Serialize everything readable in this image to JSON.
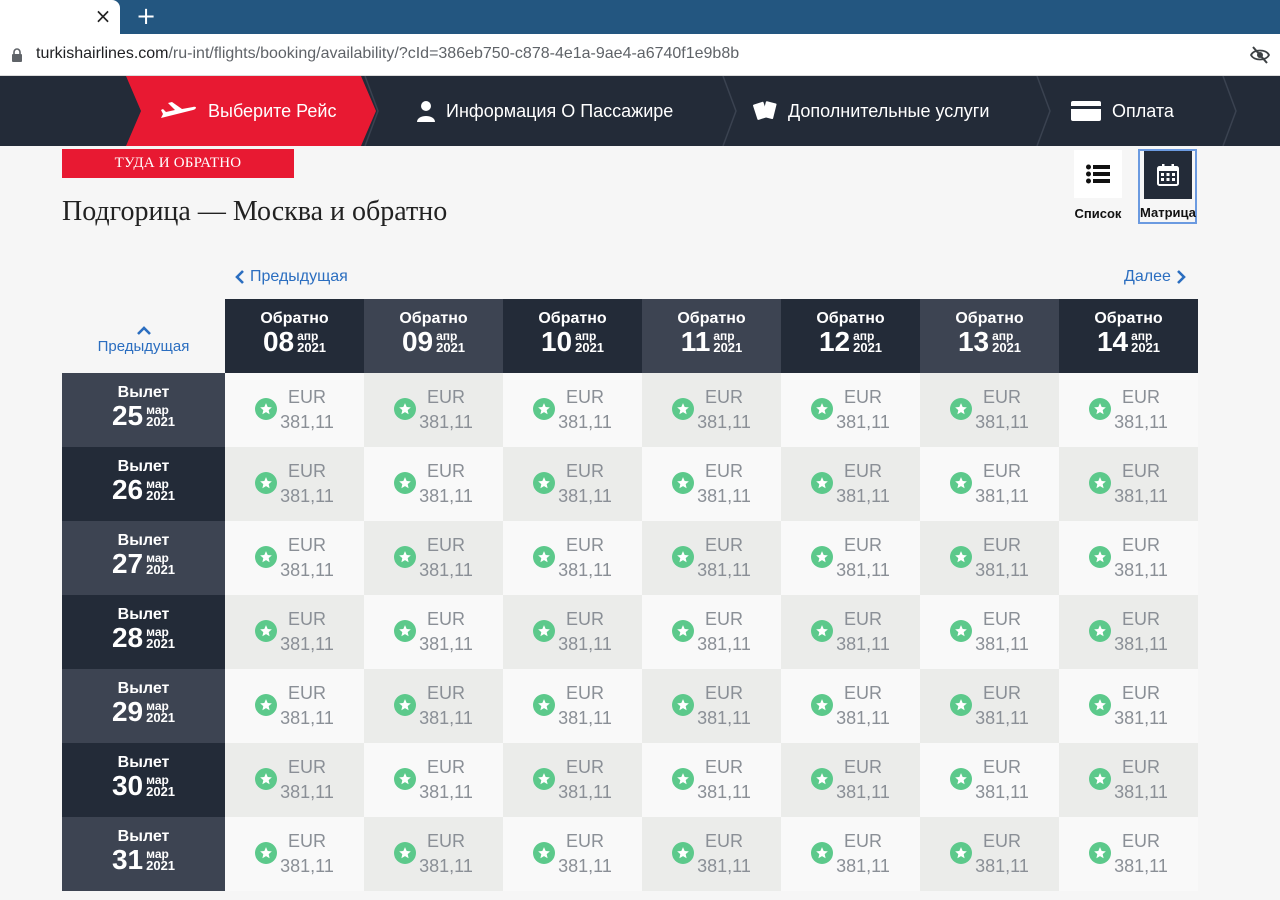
{
  "browser": {
    "tab_close": "×",
    "new_tab": "+",
    "url_host": "turkishairlines.com",
    "url_path": "/ru-int/flights/booking/availability/?cId=386eb750-c878-4e1a-9ae4-a6740f1e9b8b"
  },
  "steps": [
    {
      "label": "Выберите Рейс",
      "icon": "airplane-icon",
      "active": true
    },
    {
      "label": "Информация О Пассажире",
      "icon": "person-icon",
      "active": false
    },
    {
      "label": "Дополнительные услуги",
      "icon": "cards-icon",
      "active": false
    },
    {
      "label": "Оплата",
      "icon": "credit-card-icon",
      "active": false
    }
  ],
  "trip_badge": "ТУДА И ОБРАТНО",
  "route_title": "Подгорица — Москва и обратно",
  "view_toggle": {
    "list_label": "Список",
    "matrix_label": "Матрица",
    "selected": "matrix"
  },
  "nav": {
    "prev_horizontal": "Предыдущая",
    "next_horizontal": "Далее",
    "prev_vertical": "Предыдущая"
  },
  "return_dates": [
    {
      "label": "Обратно",
      "day": "08",
      "month": "апр",
      "year": "2021"
    },
    {
      "label": "Обратно",
      "day": "09",
      "month": "апр",
      "year": "2021"
    },
    {
      "label": "Обратно",
      "day": "10",
      "month": "апр",
      "year": "2021"
    },
    {
      "label": "Обратно",
      "day": "11",
      "month": "апр",
      "year": "2021"
    },
    {
      "label": "Обратно",
      "day": "12",
      "month": "апр",
      "year": "2021"
    },
    {
      "label": "Обратно",
      "day": "13",
      "month": "апр",
      "year": "2021"
    },
    {
      "label": "Обратно",
      "day": "14",
      "month": "апр",
      "year": "2021"
    }
  ],
  "departure_dates": [
    {
      "label": "Вылет",
      "day": "25",
      "month": "мар",
      "year": "2021"
    },
    {
      "label": "Вылет",
      "day": "26",
      "month": "мар",
      "year": "2021"
    },
    {
      "label": "Вылет",
      "day": "27",
      "month": "мар",
      "year": "2021"
    },
    {
      "label": "Вылет",
      "day": "28",
      "month": "мар",
      "year": "2021"
    },
    {
      "label": "Вылет",
      "day": "29",
      "month": "мар",
      "year": "2021"
    },
    {
      "label": "Вылет",
      "day": "30",
      "month": "мар",
      "year": "2021"
    },
    {
      "label": "Вылет",
      "day": "31",
      "month": "мар",
      "year": "2021"
    }
  ],
  "prices": [
    [
      {
        "currency": "EUR",
        "amount": "381,11"
      },
      {
        "currency": "EUR",
        "amount": "381,11"
      },
      {
        "currency": "EUR",
        "amount": "381,11"
      },
      {
        "currency": "EUR",
        "amount": "381,11"
      },
      {
        "currency": "EUR",
        "amount": "381,11"
      },
      {
        "currency": "EUR",
        "amount": "381,11"
      },
      {
        "currency": "EUR",
        "amount": "381,11"
      }
    ],
    [
      {
        "currency": "EUR",
        "amount": "381,11"
      },
      {
        "currency": "EUR",
        "amount": "381,11"
      },
      {
        "currency": "EUR",
        "amount": "381,11"
      },
      {
        "currency": "EUR",
        "amount": "381,11"
      },
      {
        "currency": "EUR",
        "amount": "381,11"
      },
      {
        "currency": "EUR",
        "amount": "381,11"
      },
      {
        "currency": "EUR",
        "amount": "381,11"
      }
    ],
    [
      {
        "currency": "EUR",
        "amount": "381,11"
      },
      {
        "currency": "EUR",
        "amount": "381,11"
      },
      {
        "currency": "EUR",
        "amount": "381,11"
      },
      {
        "currency": "EUR",
        "amount": "381,11"
      },
      {
        "currency": "EUR",
        "amount": "381,11"
      },
      {
        "currency": "EUR",
        "amount": "381,11"
      },
      {
        "currency": "EUR",
        "amount": "381,11"
      }
    ],
    [
      {
        "currency": "EUR",
        "amount": "381,11"
      },
      {
        "currency": "EUR",
        "amount": "381,11"
      },
      {
        "currency": "EUR",
        "amount": "381,11"
      },
      {
        "currency": "EUR",
        "amount": "381,11"
      },
      {
        "currency": "EUR",
        "amount": "381,11"
      },
      {
        "currency": "EUR",
        "amount": "381,11"
      },
      {
        "currency": "EUR",
        "amount": "381,11"
      }
    ],
    [
      {
        "currency": "EUR",
        "amount": "381,11"
      },
      {
        "currency": "EUR",
        "amount": "381,11"
      },
      {
        "currency": "EUR",
        "amount": "381,11"
      },
      {
        "currency": "EUR",
        "amount": "381,11"
      },
      {
        "currency": "EUR",
        "amount": "381,11"
      },
      {
        "currency": "EUR",
        "amount": "381,11"
      },
      {
        "currency": "EUR",
        "amount": "381,11"
      }
    ],
    [
      {
        "currency": "EUR",
        "amount": "381,11"
      },
      {
        "currency": "EUR",
        "amount": "381,11"
      },
      {
        "currency": "EUR",
        "amount": "381,11"
      },
      {
        "currency": "EUR",
        "amount": "381,11"
      },
      {
        "currency": "EUR",
        "amount": "381,11"
      },
      {
        "currency": "EUR",
        "amount": "381,11"
      },
      {
        "currency": "EUR",
        "amount": "381,11"
      }
    ],
    [
      {
        "currency": "EUR",
        "amount": "381,11"
      },
      {
        "currency": "EUR",
        "amount": "381,11"
      },
      {
        "currency": "EUR",
        "amount": "381,11"
      },
      {
        "currency": "EUR",
        "amount": "381,11"
      },
      {
        "currency": "EUR",
        "amount": "381,11"
      },
      {
        "currency": "EUR",
        "amount": "381,11"
      },
      {
        "currency": "EUR",
        "amount": "381,11"
      }
    ]
  ],
  "colors": {
    "brand_red": "#e81932",
    "nav_dark": "#232b38",
    "header_dark": "#232b38",
    "header_mid": "#3d4452",
    "cell_light": "#f9f9f9",
    "cell_gray": "#ebecea",
    "star_green": "#5cc98b",
    "link_blue": "#2b6ec0"
  }
}
